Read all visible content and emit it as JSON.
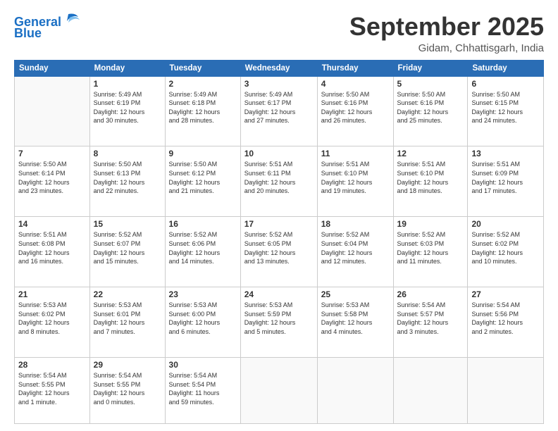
{
  "logo": {
    "line1": "General",
    "line2": "Blue"
  },
  "header": {
    "month": "September 2025",
    "location": "Gidam, Chhattisgarh, India"
  },
  "weekdays": [
    "Sunday",
    "Monday",
    "Tuesday",
    "Wednesday",
    "Thursday",
    "Friday",
    "Saturday"
  ],
  "weeks": [
    [
      {
        "day": "",
        "info": ""
      },
      {
        "day": "1",
        "info": "Sunrise: 5:49 AM\nSunset: 6:19 PM\nDaylight: 12 hours\nand 30 minutes."
      },
      {
        "day": "2",
        "info": "Sunrise: 5:49 AM\nSunset: 6:18 PM\nDaylight: 12 hours\nand 28 minutes."
      },
      {
        "day": "3",
        "info": "Sunrise: 5:49 AM\nSunset: 6:17 PM\nDaylight: 12 hours\nand 27 minutes."
      },
      {
        "day": "4",
        "info": "Sunrise: 5:50 AM\nSunset: 6:16 PM\nDaylight: 12 hours\nand 26 minutes."
      },
      {
        "day": "5",
        "info": "Sunrise: 5:50 AM\nSunset: 6:16 PM\nDaylight: 12 hours\nand 25 minutes."
      },
      {
        "day": "6",
        "info": "Sunrise: 5:50 AM\nSunset: 6:15 PM\nDaylight: 12 hours\nand 24 minutes."
      }
    ],
    [
      {
        "day": "7",
        "info": "Sunrise: 5:50 AM\nSunset: 6:14 PM\nDaylight: 12 hours\nand 23 minutes."
      },
      {
        "day": "8",
        "info": "Sunrise: 5:50 AM\nSunset: 6:13 PM\nDaylight: 12 hours\nand 22 minutes."
      },
      {
        "day": "9",
        "info": "Sunrise: 5:50 AM\nSunset: 6:12 PM\nDaylight: 12 hours\nand 21 minutes."
      },
      {
        "day": "10",
        "info": "Sunrise: 5:51 AM\nSunset: 6:11 PM\nDaylight: 12 hours\nand 20 minutes."
      },
      {
        "day": "11",
        "info": "Sunrise: 5:51 AM\nSunset: 6:10 PM\nDaylight: 12 hours\nand 19 minutes."
      },
      {
        "day": "12",
        "info": "Sunrise: 5:51 AM\nSunset: 6:10 PM\nDaylight: 12 hours\nand 18 minutes."
      },
      {
        "day": "13",
        "info": "Sunrise: 5:51 AM\nSunset: 6:09 PM\nDaylight: 12 hours\nand 17 minutes."
      }
    ],
    [
      {
        "day": "14",
        "info": "Sunrise: 5:51 AM\nSunset: 6:08 PM\nDaylight: 12 hours\nand 16 minutes."
      },
      {
        "day": "15",
        "info": "Sunrise: 5:52 AM\nSunset: 6:07 PM\nDaylight: 12 hours\nand 15 minutes."
      },
      {
        "day": "16",
        "info": "Sunrise: 5:52 AM\nSunset: 6:06 PM\nDaylight: 12 hours\nand 14 minutes."
      },
      {
        "day": "17",
        "info": "Sunrise: 5:52 AM\nSunset: 6:05 PM\nDaylight: 12 hours\nand 13 minutes."
      },
      {
        "day": "18",
        "info": "Sunrise: 5:52 AM\nSunset: 6:04 PM\nDaylight: 12 hours\nand 12 minutes."
      },
      {
        "day": "19",
        "info": "Sunrise: 5:52 AM\nSunset: 6:03 PM\nDaylight: 12 hours\nand 11 minutes."
      },
      {
        "day": "20",
        "info": "Sunrise: 5:52 AM\nSunset: 6:02 PM\nDaylight: 12 hours\nand 10 minutes."
      }
    ],
    [
      {
        "day": "21",
        "info": "Sunrise: 5:53 AM\nSunset: 6:02 PM\nDaylight: 12 hours\nand 8 minutes."
      },
      {
        "day": "22",
        "info": "Sunrise: 5:53 AM\nSunset: 6:01 PM\nDaylight: 12 hours\nand 7 minutes."
      },
      {
        "day": "23",
        "info": "Sunrise: 5:53 AM\nSunset: 6:00 PM\nDaylight: 12 hours\nand 6 minutes."
      },
      {
        "day": "24",
        "info": "Sunrise: 5:53 AM\nSunset: 5:59 PM\nDaylight: 12 hours\nand 5 minutes."
      },
      {
        "day": "25",
        "info": "Sunrise: 5:53 AM\nSunset: 5:58 PM\nDaylight: 12 hours\nand 4 minutes."
      },
      {
        "day": "26",
        "info": "Sunrise: 5:54 AM\nSunset: 5:57 PM\nDaylight: 12 hours\nand 3 minutes."
      },
      {
        "day": "27",
        "info": "Sunrise: 5:54 AM\nSunset: 5:56 PM\nDaylight: 12 hours\nand 2 minutes."
      }
    ],
    [
      {
        "day": "28",
        "info": "Sunrise: 5:54 AM\nSunset: 5:55 PM\nDaylight: 12 hours\nand 1 minute."
      },
      {
        "day": "29",
        "info": "Sunrise: 5:54 AM\nSunset: 5:55 PM\nDaylight: 12 hours\nand 0 minutes."
      },
      {
        "day": "30",
        "info": "Sunrise: 5:54 AM\nSunset: 5:54 PM\nDaylight: 11 hours\nand 59 minutes."
      },
      {
        "day": "",
        "info": ""
      },
      {
        "day": "",
        "info": ""
      },
      {
        "day": "",
        "info": ""
      },
      {
        "day": "",
        "info": ""
      }
    ]
  ]
}
